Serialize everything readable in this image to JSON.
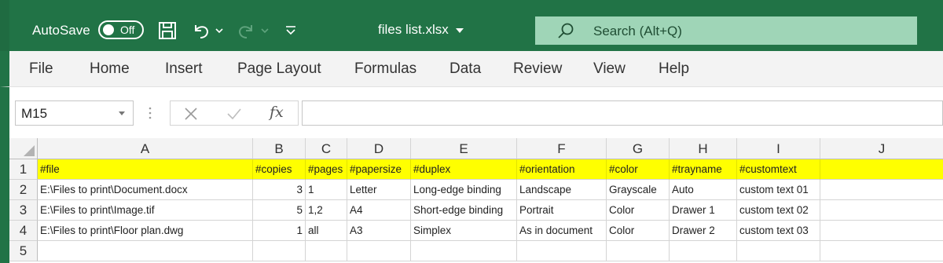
{
  "titlebar": {
    "autosave_label": "AutoSave",
    "autosave_state": "Off",
    "file_title": "files list.xlsx",
    "search_placeholder": "Search (Alt+Q)",
    "accent_color": "#217346"
  },
  "menu": [
    "File",
    "Home",
    "Insert",
    "Page Layout",
    "Formulas",
    "Data",
    "Review",
    "View",
    "Help"
  ],
  "formula_bar": {
    "name_box": "M15",
    "fx_label": "fx",
    "formula": ""
  },
  "sheet": {
    "columns": [
      "A",
      "B",
      "C",
      "D",
      "E",
      "F",
      "G",
      "H",
      "I",
      "J"
    ],
    "row_numbers": [
      "1",
      "2",
      "3",
      "4",
      "5"
    ],
    "rows": [
      [
        "#file",
        "#copies",
        "#pages",
        "#papersize",
        "#duplex",
        "#orientation",
        "#color",
        "#trayname",
        "#customtext",
        ""
      ],
      [
        "E:\\Files to print\\Document.docx",
        "3",
        "1",
        "Letter",
        "Long-edge binding",
        "Landscape",
        "Grayscale",
        "Auto",
        "custom text 01",
        ""
      ],
      [
        "E:\\Files to print\\Image.tif",
        "5",
        "1,2",
        "A4",
        "Short-edge binding",
        "Portrait",
        "Color",
        "Drawer 1",
        "custom text 02",
        ""
      ],
      [
        "E:\\Files to print\\Floor plan.dwg",
        "1",
        "all",
        "A3",
        "Simplex",
        "As in document",
        "Color",
        "Drawer 2",
        "custom text 03",
        ""
      ],
      [
        "",
        "",
        "",
        "",
        "",
        "",
        "",
        "",
        "",
        ""
      ]
    ],
    "header_row_color": "#ffff00"
  }
}
